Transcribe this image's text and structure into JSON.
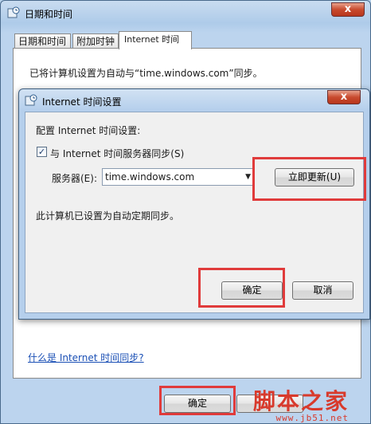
{
  "outer_window": {
    "title": "日期和时间",
    "close_label": "x",
    "tabs": [
      {
        "label": "日期和时间"
      },
      {
        "label": "附加时钟"
      },
      {
        "label": "Internet 时间"
      }
    ],
    "status_text": "已将计算机设置为自动与“time.windows.com”同步。",
    "help_link": "什么是 Internet 时间同步?",
    "ok_label": "确定"
  },
  "dialog": {
    "title": "Internet 时间设置",
    "close_label": "x",
    "heading": "配置 Internet 时间设置:",
    "sync_checkbox": {
      "label": "与 Internet 时间服务器同步(S)",
      "checked": true,
      "mark": "✓"
    },
    "server_label": "服务器(E):",
    "server_value": "time.windows.com",
    "update_now_label": "立即更新(U)",
    "status_text": "此计算机已设置为自动定期同步。",
    "ok_label": "确定",
    "cancel_label": "取消"
  },
  "watermark": {
    "main": "脚本之家",
    "url": "www.jb51.net"
  },
  "colors": {
    "highlight_box": "#e03b3b",
    "link": "#1a4fb5",
    "watermark": "#d83a2c"
  }
}
